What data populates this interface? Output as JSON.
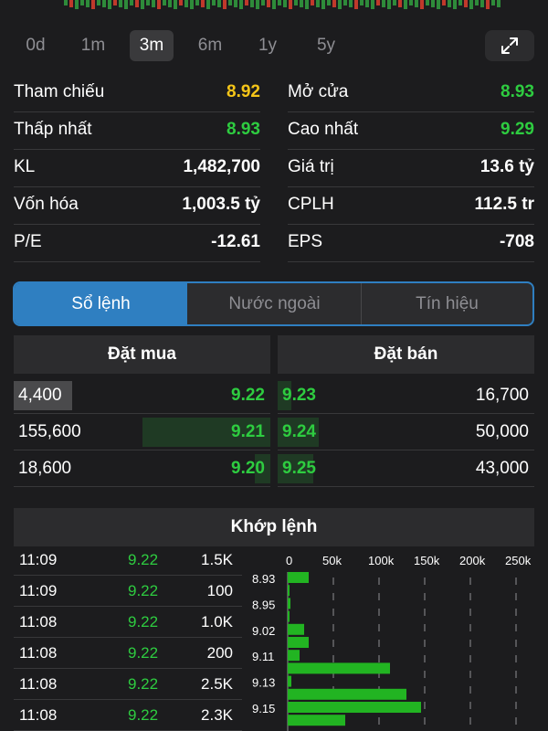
{
  "range_tabs": [
    {
      "label": "0d",
      "active": false
    },
    {
      "label": "1m",
      "active": false
    },
    {
      "label": "3m",
      "active": true
    },
    {
      "label": "6m",
      "active": false
    },
    {
      "label": "1y",
      "active": false
    },
    {
      "label": "5y",
      "active": false
    }
  ],
  "stats": {
    "left": [
      {
        "label": "Tham chiếu",
        "value": "8.92",
        "color": "#f5c518"
      },
      {
        "label": "Thấp nhất",
        "value": "8.93",
        "color": "#2ecc40"
      },
      {
        "label": "KL",
        "value": "1,482,700",
        "color": "#ffffff"
      },
      {
        "label": "Vốn hóa",
        "value": "1,003.5 tỷ",
        "color": "#ffffff"
      },
      {
        "label": "P/E",
        "value": "-12.61",
        "color": "#ffffff"
      }
    ],
    "right": [
      {
        "label": "Mở cửa",
        "value": "8.93",
        "color": "#2ecc40"
      },
      {
        "label": "Cao nhất",
        "value": "9.29",
        "color": "#2ecc40"
      },
      {
        "label": "Giá trị",
        "value": "13.6 tỷ",
        "color": "#ffffff"
      },
      {
        "label": "CPLH",
        "value": "112.5 tr",
        "color": "#ffffff"
      },
      {
        "label": "EPS",
        "value": "-708",
        "color": "#ffffff"
      }
    ]
  },
  "segment": {
    "tabs": [
      "Sổ lệnh",
      "Nước ngoài",
      "Tín hiệu"
    ],
    "active_index": 0
  },
  "orderbook": {
    "buy_header": "Đặt mua",
    "sell_header": "Đặt bán",
    "bids": [
      {
        "volume": "4,400",
        "price": "9.22",
        "depth": 0.03
      },
      {
        "volume": "155,600",
        "price": "9.21",
        "depth": 1.0
      },
      {
        "volume": "18,600",
        "price": "9.20",
        "depth": 0.12
      }
    ],
    "asks": [
      {
        "price": "9.23",
        "volume": "16,700",
        "depth": 0.11
      },
      {
        "price": "9.24",
        "volume": "50,000",
        "depth": 0.32
      },
      {
        "price": "9.25",
        "volume": "43,000",
        "depth": 0.28
      }
    ]
  },
  "matched": {
    "title": "Khớp lệnh",
    "trades": [
      {
        "time": "11:09",
        "price": "9.22",
        "volume": "1.5K"
      },
      {
        "time": "11:09",
        "price": "9.22",
        "volume": "100"
      },
      {
        "time": "11:08",
        "price": "9.22",
        "volume": "1.0K"
      },
      {
        "time": "11:08",
        "price": "9.22",
        "volume": "200"
      },
      {
        "time": "11:08",
        "price": "9.22",
        "volume": "2.5K"
      },
      {
        "time": "11:08",
        "price": "9.22",
        "volume": "2.3K"
      }
    ]
  },
  "chart_data": {
    "type": "bar",
    "orientation": "horizontal",
    "x_ticks": [
      "0",
      "50k",
      "100k",
      "150k",
      "200k",
      "250k"
    ],
    "xlim": [
      0,
      250000
    ],
    "categories": [
      "8.93",
      "",
      "8.95",
      "",
      "9.02",
      "",
      "9.11",
      "",
      "9.13",
      "",
      "9.15",
      ""
    ],
    "values": [
      23000,
      2000,
      3000,
      2000,
      18000,
      23000,
      13000,
      112000,
      4000,
      130000,
      146000,
      63000
    ],
    "bar_color": "#22b422"
  },
  "colors": {
    "up": "#2ecc40",
    "ref": "#f5c518",
    "accent": "#2f7fc1"
  },
  "icons": {
    "expand": "expand-arrows-icon"
  }
}
